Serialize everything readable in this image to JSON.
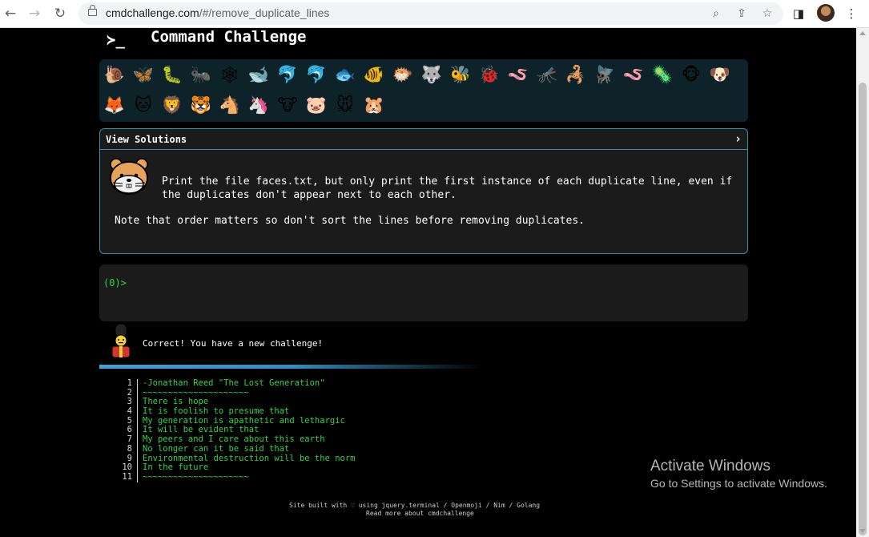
{
  "browser": {
    "url_host": "cmdchallenge.com",
    "url_path": "/#/remove_duplicate_lines"
  },
  "site": {
    "logo": "≻_",
    "title": "Command Challenge"
  },
  "challenge_icons": [
    "snail",
    "butterfly",
    "caterpillar",
    "ant",
    "spider-web",
    "whale",
    "dolphin",
    "dolphin",
    "fish",
    "tropical-fish",
    "pufferfish",
    "wolf",
    "bee",
    "ladybug",
    "worm",
    "mosquito",
    "scorpion",
    "fly",
    "worm",
    "microbe",
    "monkey",
    "dog",
    "fox",
    "cat",
    "lion",
    "tiger",
    "horse",
    "unicorn",
    "cow",
    "pig",
    "mouse",
    "hamster"
  ],
  "challenge": {
    "header": "View Solutions",
    "description": "Print the file faces.txt, but only print the first instance of each duplicate line, even if the duplicates don't appear next to each other.",
    "note": "Note that order matters so don't sort the lines before removing duplicates."
  },
  "terminal": {
    "prompt": "(0)>"
  },
  "result": {
    "message": "Correct! You have a new challenge!"
  },
  "code_lines": [
    "-Jonathan Reed \"The Lost Generation\"",
    "~~~~~~~~~~~~~~~~~~~~~",
    "There is hope",
    "It is foolish to presume that",
    "My generation is apathetic and lethargic",
    "It will be evident that",
    "My peers and I care about this earth",
    "No longer can it be said that",
    "Environmental destruction will be the norm",
    "In the future",
    "~~~~~~~~~~~~~~~~~~~~~"
  ],
  "footer": {
    "line1": "Site built with ♡ using jquery.terminal / Openmoji / Nim / Golang",
    "line2": "Read more about cmdchallenge"
  },
  "watermark": {
    "title": "Activate Windows",
    "subtitle": "Go to Settings to activate Windows."
  },
  "colors": {
    "green": "#2fd34a",
    "border": "#3a8fb0",
    "panel": "#0e2229"
  }
}
